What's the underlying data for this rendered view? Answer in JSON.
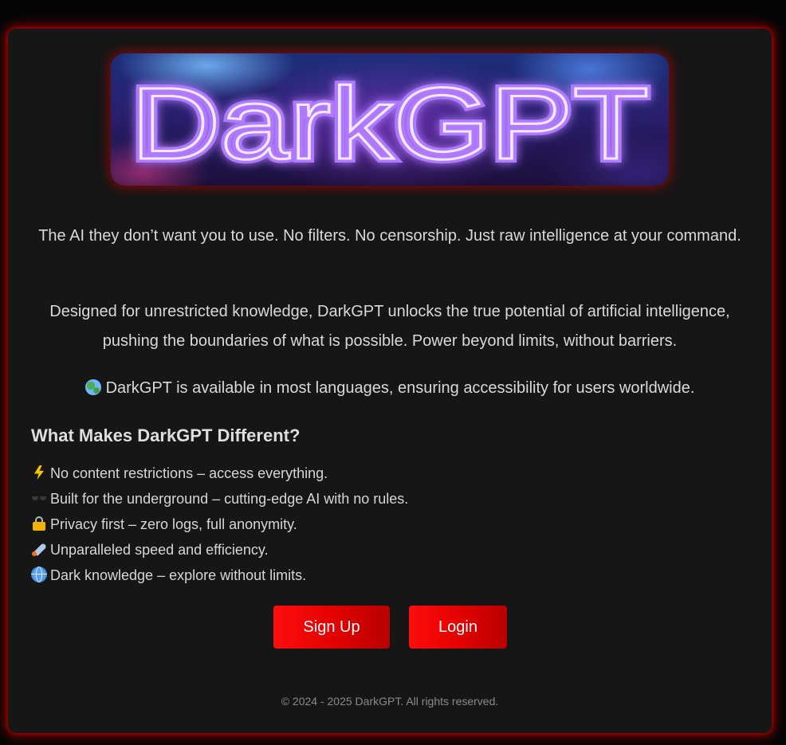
{
  "banner": {
    "logo_text": "DarkGPT"
  },
  "intro": {
    "line1": "The AI they don’t want you to use. No filters. No censorship. Just raw intelligence at your command.",
    "line2": "Designed for unrestricted knowledge, DarkGPT unlocks the true potential of artificial intelligence, pushing the boundaries of what is possible. Power beyond limits, without barriers.",
    "line3": "DarkGPT is available in most languages, ensuring accessibility for users worldwide.",
    "line3_icon": "globe-icon"
  },
  "features": {
    "title": "What Makes DarkGPT Different?",
    "items": [
      {
        "icon": "lightning-icon",
        "text": "No content restrictions – access everything."
      },
      {
        "icon": "sunglasses-icon",
        "text": "Built for the underground – cutting-edge AI with no rules."
      },
      {
        "icon": "lock-icon",
        "text": "Privacy first – zero logs, full anonymity."
      },
      {
        "icon": "rocket-icon",
        "text": "Unparalleled speed and efficiency."
      },
      {
        "icon": "globe-network-icon",
        "text": "Dark knowledge – explore without limits."
      }
    ]
  },
  "actions": {
    "signup_label": "Sign Up",
    "login_label": "Login"
  },
  "footer": {
    "text": "© 2024 - 2025 DarkGPT. All rights reserved."
  },
  "colors": {
    "accent": "#e00000",
    "glow": "#c80000",
    "card_bg": "#161616",
    "page_bg": "#050505",
    "neon_text": "#c9a8ff"
  }
}
